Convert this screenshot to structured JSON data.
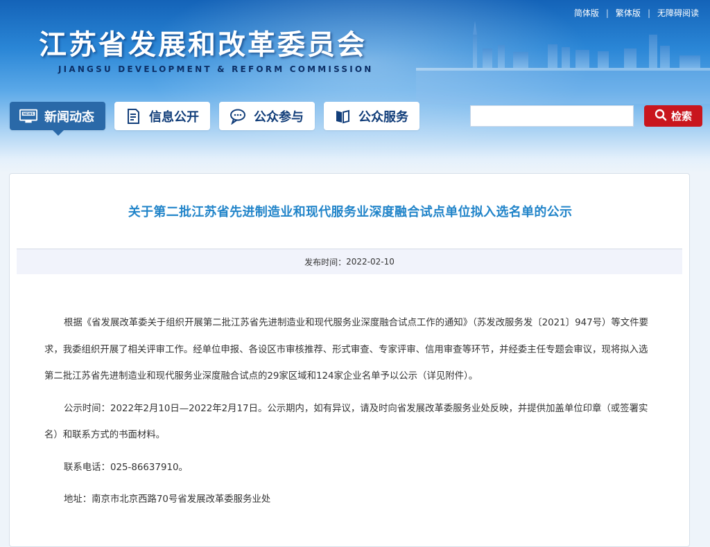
{
  "header": {
    "title_cn": "江苏省发展和改革委员会",
    "title_en": "JIANGSU DEVELOPMENT & REFORM COMMISSION",
    "top_links": [
      "简体版",
      "繁体版",
      "无障碍阅读"
    ],
    "separator": "|"
  },
  "nav": {
    "items": [
      {
        "label": "新闻动态",
        "icon": "news-icon",
        "active": true
      },
      {
        "label": "信息公开",
        "icon": "document-icon",
        "active": false
      },
      {
        "label": "公众参与",
        "icon": "chat-icon",
        "active": false
      },
      {
        "label": "公众服务",
        "icon": "book-icon",
        "active": false
      }
    ],
    "news_icon_text": "NEWS"
  },
  "search": {
    "placeholder": "",
    "button_label": "检索"
  },
  "article": {
    "title": "关于第二批江苏省先进制造业和现代服务业深度融合试点单位拟入选名单的公示",
    "publish_label": "发布时间：",
    "publish_date": "2022-02-10",
    "paragraphs": [
      "根据《省发展改革委关于组织开展第二批江苏省先进制造业和现代服务业深度融合试点工作的通知》（苏发改服务发〔2021〕947号）等文件要求，我委组织开展了相关评审工作。经单位申报、各设区市审核推荐、形式审查、专家评审、信用审查等环节，并经委主任专题会审议，现将拟入选第二批江苏省先进制造业和现代服务业深度融合试点的29家区域和124家企业名单予以公示（详见附件）。",
      "公示时间：2022年2月10日—2022年2月17日。公示期内，如有异议，请及时向省发展改革委服务业处反映，并提供加盖单位印章（或签署实名）和联系方式的书面材料。",
      "联系电话：025-86637910。",
      "地址：南京市北京西路70号省发展改革委服务业处"
    ]
  },
  "colors": {
    "nav_active": "#2a69a8",
    "search_button": "#c9161e",
    "title_text": "#2184c9"
  }
}
